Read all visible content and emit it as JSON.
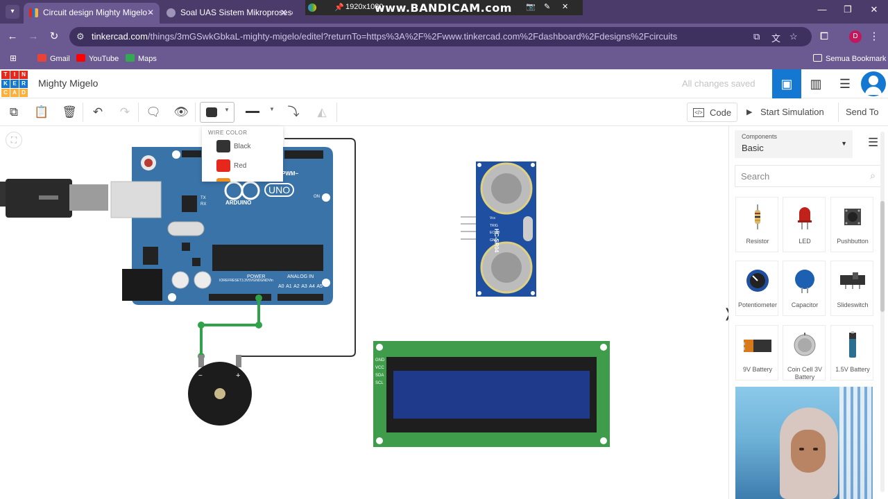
{
  "browser": {
    "tabs": [
      {
        "title": "Circuit design Mighty Migelo -",
        "active": true
      },
      {
        "title": "Soal UAS Sistem Mikroprosesor",
        "active": false
      }
    ],
    "recorder": {
      "resolution": "1920x1080",
      "watermark": "www.BANDICAM.com"
    },
    "url_host": "tinkercad.com",
    "url_path": "/things/3mGSwkGbkaL-mighty-migelo/editel?returnTo=https%3A%2F%2Fwww.tinkercad.com%2Fdashboard%2Fdesigns%2Fcircuits",
    "profile_initial": "D",
    "bookmarks": [
      {
        "label": "Gmail",
        "color": "#ea4335"
      },
      {
        "label": "YouTube",
        "color": "#ff0000"
      },
      {
        "label": "Maps",
        "color": "#34a853"
      }
    ],
    "all_bookmarks_label": "Semua Bookmark"
  },
  "app": {
    "logo_letters": [
      "TIN",
      "KER",
      "CAD"
    ],
    "design_name": "Mighty Migelo",
    "save_status": "All changes saved"
  },
  "toolbar": {
    "code_label": "Code",
    "start_simulation_label": "Start Simulation",
    "send_to_label": "Send To",
    "wire_color_swatch": "#333333"
  },
  "wire_color_popup": {
    "header": "WIRE COLOR",
    "options": [
      {
        "label": "Black",
        "color": "#333333"
      },
      {
        "label": "Red",
        "color": "#e5271c"
      }
    ]
  },
  "canvas": {
    "arduino": {
      "brand": "ARDUINO",
      "model": "UNO",
      "labels": {
        "pwm": "PWM~",
        "power": "POWER",
        "analog_in": "ANALOG IN",
        "on": "ON",
        "tx": "TX",
        "rx": "RX"
      },
      "power_pins": [
        "IOREF",
        "RESET",
        "3.3V",
        "5V",
        "GND",
        "GND",
        "Vin"
      ],
      "analog_pins": [
        "A0",
        "A1",
        "A2",
        "A3",
        "A4",
        "A5"
      ]
    },
    "ultrasonic": {
      "model": "HC-SR04",
      "pins": [
        "Vcc",
        "TRIG",
        "ECHO",
        "GND"
      ]
    },
    "lcd": {
      "pins": [
        "GND",
        "VCC",
        "SDA",
        "SCL"
      ]
    },
    "buzzer": {
      "minus": "−",
      "plus": "+"
    }
  },
  "sidebar": {
    "components_label": "Components",
    "components_value": "Basic",
    "search_placeholder": "Search",
    "components": [
      {
        "label": "Resistor"
      },
      {
        "label": "LED"
      },
      {
        "label": "Pushbutton"
      },
      {
        "label": "Potentiometer"
      },
      {
        "label": "Capacitor"
      },
      {
        "label": "Slideswitch"
      },
      {
        "label": "9V Battery"
      },
      {
        "label": "Coin Cell 3V Battery"
      },
      {
        "label": "1.5V Battery"
      }
    ]
  }
}
